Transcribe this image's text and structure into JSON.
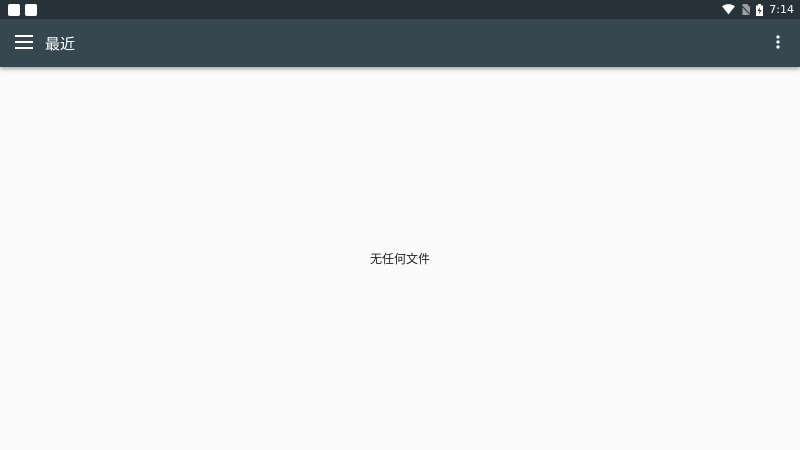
{
  "status_bar": {
    "time": "7:14",
    "icons": [
      "notification-square-icon",
      "notification-square-icon",
      "wifi-icon",
      "no-sim-icon",
      "battery-charging-icon"
    ]
  },
  "toolbar": {
    "title": "最近",
    "menu_icon": "hamburger-menu-icon",
    "overflow_icon": "more-vert-icon"
  },
  "content": {
    "empty_message": "无任何文件"
  },
  "colors": {
    "status_bar": "#263238",
    "toolbar": "#37474f",
    "background": "#fafafa",
    "text": "#212121"
  }
}
